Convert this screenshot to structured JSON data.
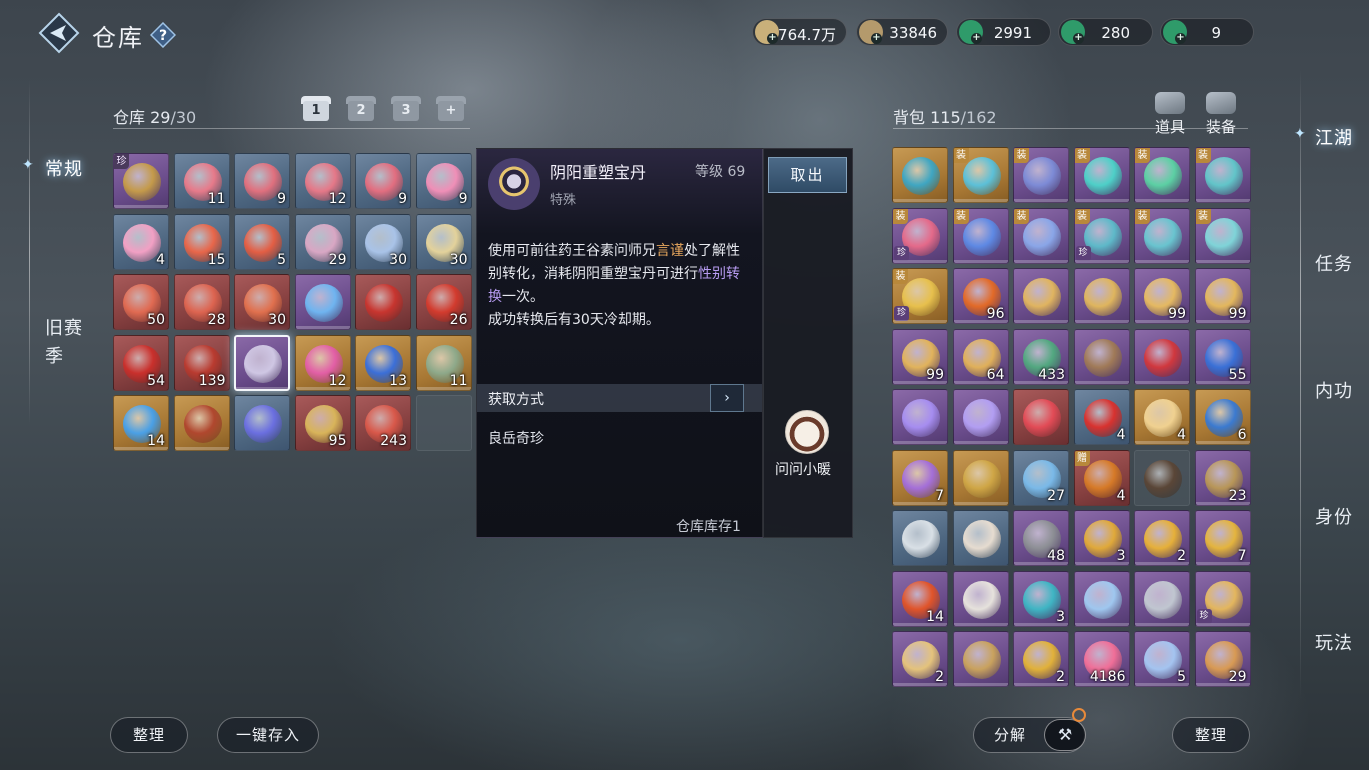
{
  "header": {
    "title": "仓库",
    "help_icon": "question-icon"
  },
  "currencies": [
    {
      "icon": "silver-scroll-icon",
      "value": "764.7万",
      "color": "#c9b07a"
    },
    {
      "icon": "coin-pouch-icon",
      "value": "33846",
      "color": "#b49a6c"
    },
    {
      "icon": "jade-coin-icon",
      "value": "2991",
      "color": "#2f9b6a"
    },
    {
      "icon": "jade-coin-icon",
      "value": "280",
      "color": "#2f9b6a"
    },
    {
      "icon": "jade-coin-icon",
      "value": "9",
      "color": "#2f9b6a"
    }
  ],
  "left_tabs": [
    {
      "label": "常规",
      "active": true
    },
    {
      "label": "旧赛季",
      "active": false
    }
  ],
  "right_tabs": [
    {
      "label": "江湖",
      "active": true
    },
    {
      "label": "任务",
      "active": false
    },
    {
      "label": "内功",
      "active": false
    },
    {
      "label": "身份",
      "active": false
    },
    {
      "label": "玩法",
      "active": false
    }
  ],
  "warehouse": {
    "label": "仓库",
    "used": "29",
    "capacity": "/30",
    "pages": [
      "1",
      "2",
      "3",
      "+"
    ],
    "items": [
      {
        "color": "p",
        "count": "",
        "tag": "珍",
        "icon": "necklace-icon",
        "art": "#c49a4a"
      },
      {
        "color": "b",
        "count": "11",
        "icon": "heart-icon",
        "art": "#e77a8a"
      },
      {
        "color": "b",
        "count": "9",
        "icon": "heart-icon",
        "art": "#e0707e"
      },
      {
        "color": "b",
        "count": "12",
        "icon": "heart-icon",
        "art": "#e57888"
      },
      {
        "color": "b",
        "count": "9",
        "icon": "heart-icon",
        "art": "#e26e80"
      },
      {
        "color": "b",
        "count": "9",
        "icon": "double-heart-icon",
        "art": "#ef8fb7"
      },
      {
        "color": "b",
        "count": "4",
        "icon": "double-heart-icon",
        "art": "#f2a0c4"
      },
      {
        "color": "b",
        "count": "15",
        "icon": "lantern-icon",
        "art": "#e8664a"
      },
      {
        "color": "b",
        "count": "5",
        "icon": "lantern-icon",
        "art": "#e35e44"
      },
      {
        "color": "b",
        "count": "29",
        "icon": "heart-outline-icon",
        "art": "#d9a7c4"
      },
      {
        "color": "b",
        "count": "30",
        "icon": "heart-outline-icon",
        "art": "#a9c3e8"
      },
      {
        "color": "b",
        "count": "30",
        "icon": "heart-outline-icon",
        "art": "#e3d29b"
      },
      {
        "color": "r",
        "count": "50",
        "icon": "cat-face-icon",
        "art": "#e06a52"
      },
      {
        "color": "r",
        "count": "28",
        "icon": "cat-face-icon",
        "art": "#dd6450"
      },
      {
        "color": "r",
        "count": "30",
        "icon": "cat-face-icon",
        "art": "#e0704e"
      },
      {
        "color": "p",
        "count": "",
        "icon": "butterfly-icon",
        "art": "#6fb4f0"
      },
      {
        "color": "r",
        "count": "",
        "icon": "firecracker-icon",
        "art": "#c7352f"
      },
      {
        "color": "r",
        "count": "26",
        "icon": "gift-box-icon",
        "art": "#d23b2e"
      },
      {
        "color": "r",
        "count": "54",
        "icon": "firecracker-bundle-icon",
        "art": "#c9302c"
      },
      {
        "color": "r",
        "count": "139",
        "icon": "firecracker-icon",
        "art": "#b93b30"
      },
      {
        "color": "p",
        "count": "",
        "icon": "pearl-dan-icon",
        "art": "#cfc7e4",
        "selected": true
      },
      {
        "color": "o",
        "count": "12",
        "icon": "pink-orb-icon",
        "art": "#e25fa6"
      },
      {
        "color": "o",
        "count": "13",
        "icon": "blue-orb-icon",
        "art": "#3b6fd8"
      },
      {
        "color": "o",
        "count": "11",
        "icon": "stone-icon",
        "art": "#8ea98a"
      },
      {
        "color": "o",
        "count": "14",
        "icon": "crystal-icon",
        "art": "#4aa0e6"
      },
      {
        "color": "o",
        "count": "",
        "icon": "treasure-chest-icon",
        "art": "#b0472e"
      },
      {
        "color": "b",
        "count": "",
        "icon": "ticket-icon",
        "art": "#6b6fe0"
      },
      {
        "color": "r",
        "count": "95",
        "icon": "scroll-icon",
        "art": "#d8b45a"
      },
      {
        "color": "r",
        "count": "243",
        "icon": "firecracker-icon",
        "art": "#d8584a"
      },
      {
        "color": "e",
        "count": "",
        "icon": "empty-slot-icon",
        "art": ""
      }
    ]
  },
  "tooltip": {
    "name": "阴阳重塑宝丹",
    "level": "等级 69",
    "category": "特殊",
    "desc": {
      "p1": "使用可前往药王谷素问师兄",
      "hl1": "言谨",
      "p2": "处了解性别转化，消耗阴阳重塑宝丹可进行",
      "hl2": "性别转换",
      "p3": "一次。",
      "p4": "成功转换后有30天冷却期。"
    },
    "source_label": "获取方式",
    "source_text": "良岳奇珍",
    "stock": "仓库库存1",
    "take_button": "取出",
    "npc_name": "问问小暖"
  },
  "bag": {
    "label": "背包",
    "used": "115",
    "capacity": "/162",
    "tabs": [
      "道具",
      "装备"
    ],
    "items": [
      {
        "color": "o",
        "count": "",
        "icon": "ring-icon",
        "art": "#3fa6c2"
      },
      {
        "color": "o",
        "count": "",
        "tag": "装",
        "icon": "ring-icon",
        "art": "#5cc0d8"
      },
      {
        "color": "p",
        "count": "",
        "tag": "装",
        "icon": "boots-icon",
        "art": "#7d8bd6"
      },
      {
        "color": "p",
        "count": "",
        "tag": "装",
        "icon": "ring-icon",
        "art": "#4ed0c8"
      },
      {
        "color": "p",
        "count": "",
        "tag": "装",
        "icon": "bracelet-icon",
        "art": "#5cd0a4"
      },
      {
        "color": "p",
        "count": "",
        "tag": "装",
        "icon": "necklace-icon",
        "art": "#62c5c9"
      },
      {
        "color": "p",
        "count": "",
        "tag": "装",
        "rare": "珍",
        "icon": "staff-icon",
        "art": "#e46a8a"
      },
      {
        "color": "p",
        "count": "",
        "tag": "装",
        "icon": "belt-icon",
        "art": "#5e89e4"
      },
      {
        "color": "p",
        "count": "",
        "tag": "装",
        "icon": "gauntlet-icon",
        "art": "#8aa6e8"
      },
      {
        "color": "p",
        "count": "",
        "tag": "装",
        "rare": "珍",
        "icon": "armor-icon",
        "art": "#5eb9c9"
      },
      {
        "color": "p",
        "count": "",
        "tag": "装",
        "icon": "bracer-icon",
        "art": "#69c4cf"
      },
      {
        "color": "p",
        "count": "",
        "tag": "装",
        "icon": "blade-icon",
        "art": "#7fd4d8"
      },
      {
        "color": "o",
        "count": "",
        "tag": "装",
        "rare": "珍",
        "icon": "crown-icon",
        "art": "#e7c04d"
      },
      {
        "color": "p",
        "count": "96",
        "icon": "amber-gem-icon",
        "art": "#e26a28"
      },
      {
        "color": "p",
        "count": "",
        "icon": "scroll-icon",
        "art": "#e0b460"
      },
      {
        "color": "p",
        "count": "",
        "icon": "scroll-icon",
        "art": "#dfb55e"
      },
      {
        "color": "p",
        "count": "99",
        "icon": "scroll-icon",
        "art": "#e5b962"
      },
      {
        "color": "p",
        "count": "99",
        "icon": "scroll-icon",
        "art": "#e3b75d"
      },
      {
        "color": "p",
        "count": "99",
        "icon": "scroll-icon",
        "art": "#e1b35c"
      },
      {
        "color": "p",
        "count": "64",
        "icon": "scroll-icon",
        "art": "#e0b05a"
      },
      {
        "color": "p",
        "count": "433",
        "icon": "jade-block-icon",
        "art": "#52a880"
      },
      {
        "color": "p",
        "count": "",
        "icon": "crossed-sticks-icon",
        "art": "#a07a58"
      },
      {
        "color": "p",
        "count": "",
        "icon": "bell-icon",
        "art": "#d0383e"
      },
      {
        "color": "p",
        "count": "55",
        "icon": "bell-icon",
        "art": "#3a70d6"
      },
      {
        "color": "p",
        "count": "",
        "icon": "crystal-cluster-icon",
        "art": "#a68df0"
      },
      {
        "color": "p",
        "count": "",
        "icon": "crystal-cluster-icon",
        "art": "#b29ef2"
      },
      {
        "color": "r",
        "count": "",
        "icon": "flower-bouquet-icon",
        "art": "#e24b56"
      },
      {
        "color": "b",
        "count": "4",
        "icon": "fortune-card-icon",
        "art": "#d8322f"
      },
      {
        "color": "o",
        "count": "4",
        "icon": "sail-coin-icon",
        "art": "#f0d190"
      },
      {
        "color": "o",
        "count": "6",
        "icon": "compass-coin-icon",
        "art": "#3b7ad0"
      },
      {
        "color": "o",
        "count": "7",
        "icon": "moon-orb-icon",
        "art": "#a46fd8"
      },
      {
        "color": "o",
        "count": "",
        "icon": "bird-token-icon",
        "art": "#cfa646"
      },
      {
        "color": "b",
        "count": "27",
        "icon": "letter-icon",
        "art": "#7ab9e8"
      },
      {
        "color": "r",
        "count": "4",
        "tag": "赠",
        "icon": "ember-icon",
        "art": "#d67a28"
      },
      {
        "color": "e",
        "count": "",
        "icon": "table-icon",
        "art": "#5a4637"
      },
      {
        "color": "p",
        "count": "23",
        "icon": "medallion-icon",
        "art": "#b89658"
      },
      {
        "color": "b",
        "count": "",
        "icon": "bowl-spoon-icon",
        "art": "#d9e0e6"
      },
      {
        "color": "b",
        "count": "",
        "icon": "bowl-spoon-icon",
        "art": "#e6dcd0"
      },
      {
        "color": "p",
        "count": "48",
        "icon": "stone-tablet-icon",
        "art": "#8d8f95"
      },
      {
        "color": "p",
        "count": "3",
        "icon": "golden-blade-icon",
        "art": "#e0a93a"
      },
      {
        "color": "p",
        "count": "2",
        "icon": "gold-pile-icon",
        "art": "#e6b03a"
      },
      {
        "color": "p",
        "count": "7",
        "icon": "gold-leaf-icon",
        "art": "#e4b43e"
      },
      {
        "color": "p",
        "count": "14",
        "icon": "fire-orb-icon",
        "art": "#e0542a"
      },
      {
        "color": "p",
        "count": "",
        "icon": "gourd-icon",
        "art": "#e6e2dc"
      },
      {
        "color": "p",
        "count": "3",
        "icon": "teal-crystal-icon",
        "art": "#3fb5c4"
      },
      {
        "color": "p",
        "count": "",
        "icon": "ice-shard-icon",
        "art": "#9fc7ef"
      },
      {
        "color": "p",
        "count": "",
        "icon": "silver-feather-icon",
        "art": "#c0c6d0"
      },
      {
        "color": "p",
        "count": "",
        "rare": "珍",
        "icon": "fire-scroll-icon",
        "art": "#e3b65e"
      },
      {
        "color": "p",
        "count": "2",
        "icon": "scroll-icon",
        "art": "#e4c37c"
      },
      {
        "color": "p",
        "count": "",
        "icon": "brush-icon",
        "art": "#c9a25e"
      },
      {
        "color": "p",
        "count": "2",
        "icon": "gold-coin-icon",
        "art": "#e1b13a"
      },
      {
        "color": "p",
        "count": "4186",
        "icon": "heart-token-icon",
        "art": "#f06f98"
      },
      {
        "color": "p",
        "count": "5",
        "icon": "pearl-plate-icon",
        "art": "#a4c4f0"
      },
      {
        "color": "p",
        "count": "29",
        "icon": "fan-icon",
        "art": "#d89a54"
      }
    ]
  },
  "footer": {
    "left_sort": "整理",
    "deposit_all": "一键存入",
    "decompose": "分解",
    "right_sort": "整理"
  }
}
